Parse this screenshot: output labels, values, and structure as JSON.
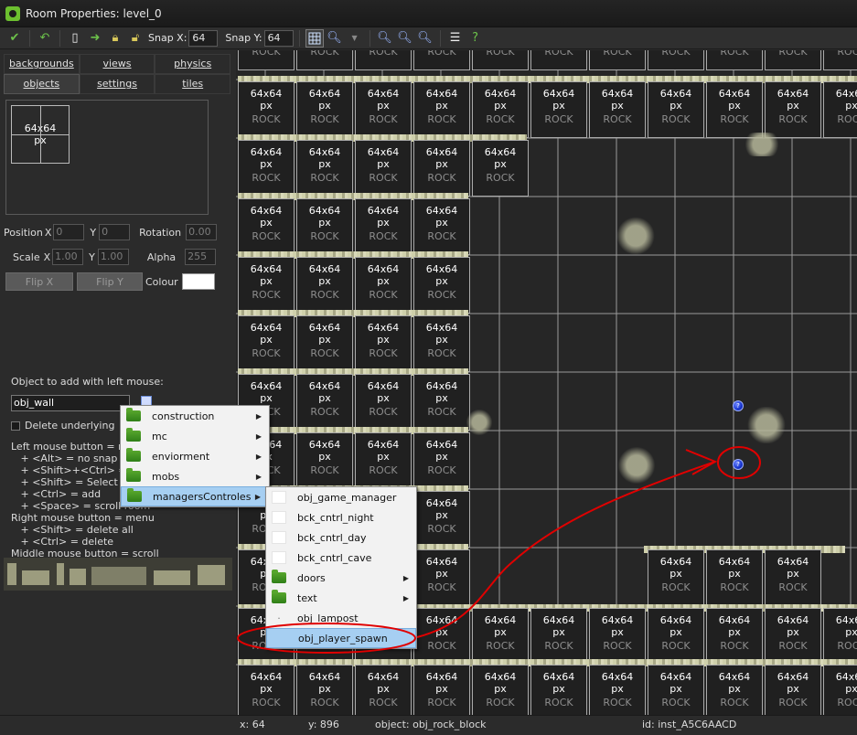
{
  "window": {
    "title": "Room Properties: level_0"
  },
  "toolbar": {
    "snap_x_label": "Snap X:",
    "snap_x_value": "64",
    "snap_y_label": "Snap Y:",
    "snap_y_value": "64"
  },
  "tabs": {
    "row1": [
      "backgrounds",
      "views",
      "physics"
    ],
    "row2": [
      "objects",
      "settings",
      "tiles"
    ]
  },
  "preview": {
    "line1": "64x64",
    "line2": "px"
  },
  "properties": {
    "position_label": "Position",
    "x_label": "X",
    "x_value": "0",
    "y_label": "Y",
    "y_value": "0",
    "rotation_label": "Rotation",
    "rotation_value": "0.00",
    "scale_label": "Scale",
    "scale_x_label": "X",
    "scale_x_value": "1.00",
    "scale_y_label": "Y",
    "scale_y_value": "1.00",
    "alpha_label": "Alpha",
    "alpha_value": "255",
    "flipx_label": "Flip X",
    "flipy_label": "Flip Y",
    "colour_label": "Colour",
    "colour_value": "#ffffff"
  },
  "object_add": {
    "label": "Object to add with left mouse:",
    "value": "obj_wall",
    "delete_underlying_label": "Delete underlying",
    "help": "Left mouse button = move\n   + <Alt> = no snap\n   + <Shift>+<Ctrl> = add t\n   + <Shift> = Select multi\n   + <Ctrl> = add\n   + <Space> = scroll room\nRight mouse button = menu\n   + <Shift> = delete all\n   + <Ctrl> = delete\nMiddle mouse button = scroll"
  },
  "tile": {
    "line1": "64x64",
    "line2": "px",
    "line3": "ROCK"
  },
  "menu1": [
    {
      "label": "construction",
      "submenu": true
    },
    {
      "label": "mc",
      "submenu": true
    },
    {
      "label": "enviorment",
      "submenu": true
    },
    {
      "label": "mobs",
      "submenu": true
    },
    {
      "label": "managersControles",
      "submenu": true
    }
  ],
  "menu2": [
    {
      "label": "obj_game_manager",
      "kind": "object"
    },
    {
      "label": "bck_cntrl_night",
      "kind": "object"
    },
    {
      "label": "bck_cntrl_day",
      "kind": "object"
    },
    {
      "label": "bck_cntrl_cave",
      "kind": "object"
    },
    {
      "label": "doors",
      "kind": "folder"
    },
    {
      "label": "text",
      "kind": "folder"
    },
    {
      "label": "obj_lampost",
      "kind": "object"
    },
    {
      "label": "obj_player_spawn",
      "kind": "object"
    }
  ],
  "status": {
    "x": "x: 64",
    "y": "y: 896",
    "object": "object: obj_rock_block",
    "id": "id: inst_A5C6AACD"
  },
  "colors": {
    "annotation_red": "#e00000",
    "highlight": "#a6cff2",
    "spawn_blue": "#1532cc"
  }
}
